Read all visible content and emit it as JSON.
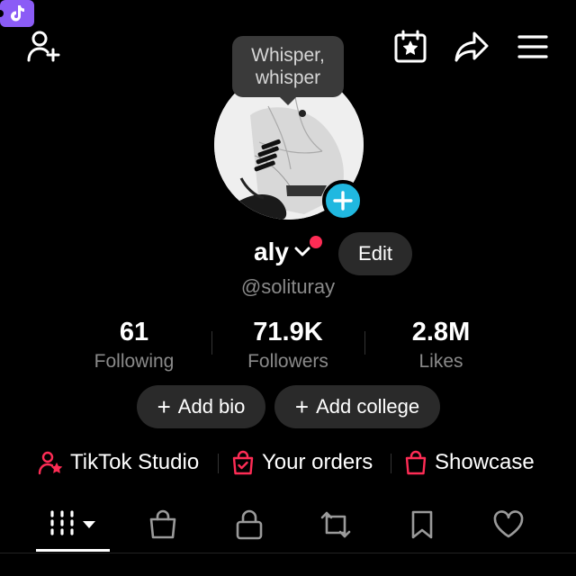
{
  "header": {
    "icons": [
      "add-friend-icon",
      "ticket-icon",
      "calendar-star-icon",
      "share-icon",
      "menu-icon"
    ],
    "accent_ticket": "#8b5cf6"
  },
  "profile": {
    "bubble_line1": "Whisper,",
    "bubble_line2": "whisper",
    "name": "aly",
    "edit_label": "Edit",
    "handle": "@solituray",
    "add_avatar_color": "#20b8e0",
    "notification_dot_color": "#fe2c55"
  },
  "stats": [
    {
      "value": "61",
      "label": "Following"
    },
    {
      "value": "71.9K",
      "label": "Followers"
    },
    {
      "value": "2.8M",
      "label": "Likes"
    }
  ],
  "actions": {
    "add_bio": "Add bio",
    "add_college": "Add college",
    "plus": "+"
  },
  "shortcuts": [
    {
      "label": "TikTok Studio",
      "icon": "person-star-icon"
    },
    {
      "label": "Your orders",
      "icon": "bag-check-icon"
    },
    {
      "label": "Showcase",
      "icon": "shopping-bag-icon"
    }
  ],
  "tabs": [
    {
      "name": "videos-grid",
      "icon": "grid-dropdown-icon",
      "active": true
    },
    {
      "name": "shop",
      "icon": "shopping-bag-icon"
    },
    {
      "name": "private",
      "icon": "lock-icon"
    },
    {
      "name": "reposts",
      "icon": "repost-icon"
    },
    {
      "name": "saved",
      "icon": "bookmark-icon"
    },
    {
      "name": "liked",
      "icon": "heart-icon"
    }
  ]
}
